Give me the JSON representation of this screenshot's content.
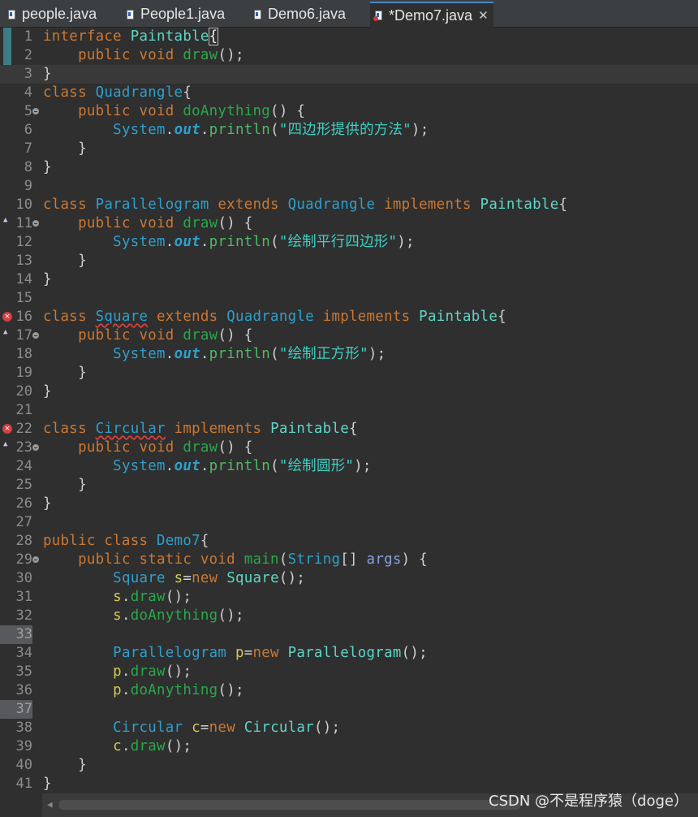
{
  "tabs": [
    {
      "label": "people.java",
      "icon": "java-file-icon"
    },
    {
      "label": "People1.java",
      "icon": "java-file-icon"
    },
    {
      "label": "Demo6.java",
      "icon": "java-file-icon"
    },
    {
      "label": "*Demo7.java",
      "icon": "java-file-error-icon",
      "close": "✕"
    }
  ],
  "editor": {
    "current_line": 3,
    "selected_line_numbers": [
      33,
      37
    ],
    "error_lines": [
      16,
      22
    ],
    "override_marker_lines": [
      11,
      17,
      23
    ],
    "fold_lines": [
      5,
      11,
      17,
      23,
      29
    ],
    "lines": [
      [
        [
          "kw",
          "interface "
        ],
        [
          "cls2",
          "Paintable"
        ],
        [
          "brk",
          "{"
        ]
      ],
      [
        [
          "pl",
          "    "
        ],
        [
          "kw",
          "public "
        ],
        [
          "kw",
          "void "
        ],
        [
          "fn",
          "draw"
        ],
        [
          "pl",
          "();"
        ]
      ],
      [
        [
          "pl",
          "}"
        ]
      ],
      [
        [
          "kw",
          "class "
        ],
        [
          "cls",
          "Quadrangle"
        ],
        [
          "pl",
          "{"
        ]
      ],
      [
        [
          "pl",
          "    "
        ],
        [
          "kw",
          "public "
        ],
        [
          "kw",
          "void "
        ],
        [
          "fn",
          "doAnything"
        ],
        [
          "pl",
          "() {"
        ]
      ],
      [
        [
          "pl",
          "        "
        ],
        [
          "cls",
          "System"
        ],
        [
          "pl",
          "."
        ],
        [
          "st",
          "out"
        ],
        [
          "pl",
          "."
        ],
        [
          "fnb",
          "println"
        ],
        [
          "pl",
          "("
        ],
        [
          "str",
          "\"四边形提供的方法\""
        ],
        [
          "pl",
          ");"
        ]
      ],
      [
        [
          "pl",
          "    }"
        ]
      ],
      [
        [
          "pl",
          "}"
        ]
      ],
      [],
      [
        [
          "kw",
          "class "
        ],
        [
          "cls",
          "Parallelogram "
        ],
        [
          "kw",
          "extends "
        ],
        [
          "cls",
          "Quadrangle "
        ],
        [
          "kw",
          "implements "
        ],
        [
          "cls2",
          "Paintable"
        ],
        [
          "pl",
          "{"
        ]
      ],
      [
        [
          "pl",
          "    "
        ],
        [
          "kw",
          "public "
        ],
        [
          "kw",
          "void "
        ],
        [
          "fn",
          "draw"
        ],
        [
          "pl",
          "() {"
        ]
      ],
      [
        [
          "pl",
          "        "
        ],
        [
          "cls",
          "System"
        ],
        [
          "pl",
          "."
        ],
        [
          "st",
          "out"
        ],
        [
          "pl",
          "."
        ],
        [
          "fnb",
          "println"
        ],
        [
          "pl",
          "("
        ],
        [
          "str",
          "\"绘制平行四边形\""
        ],
        [
          "pl",
          ");"
        ]
      ],
      [
        [
          "pl",
          "    }"
        ]
      ],
      [
        [
          "pl",
          "}"
        ]
      ],
      [],
      [
        [
          "kw",
          "class "
        ],
        [
          "cls wavy",
          "Square"
        ],
        [
          "pl",
          " "
        ],
        [
          "kw",
          "extends "
        ],
        [
          "cls",
          "Quadrangle "
        ],
        [
          "kw",
          "implements "
        ],
        [
          "cls2",
          "Paintable"
        ],
        [
          "pl",
          "{"
        ]
      ],
      [
        [
          "pl",
          "    "
        ],
        [
          "kw",
          "public "
        ],
        [
          "kw",
          "void "
        ],
        [
          "fn",
          "draw"
        ],
        [
          "pl",
          "() {"
        ]
      ],
      [
        [
          "pl",
          "        "
        ],
        [
          "cls",
          "System"
        ],
        [
          "pl",
          "."
        ],
        [
          "st",
          "out"
        ],
        [
          "pl",
          "."
        ],
        [
          "fnb",
          "println"
        ],
        [
          "pl",
          "("
        ],
        [
          "str",
          "\"绘制正方形\""
        ],
        [
          "pl",
          ");"
        ]
      ],
      [
        [
          "pl",
          "    }"
        ]
      ],
      [
        [
          "pl",
          "}"
        ]
      ],
      [],
      [
        [
          "kw",
          "class "
        ],
        [
          "cls wavy",
          "Circular"
        ],
        [
          "pl",
          " "
        ],
        [
          "kw",
          "implements "
        ],
        [
          "cls2",
          "Paintable"
        ],
        [
          "pl",
          "{"
        ]
      ],
      [
        [
          "pl",
          "    "
        ],
        [
          "kw",
          "public "
        ],
        [
          "kw",
          "void "
        ],
        [
          "fn",
          "draw"
        ],
        [
          "pl",
          "() {"
        ]
      ],
      [
        [
          "pl",
          "        "
        ],
        [
          "cls",
          "System"
        ],
        [
          "pl",
          "."
        ],
        [
          "st",
          "out"
        ],
        [
          "pl",
          "."
        ],
        [
          "fnb",
          "println"
        ],
        [
          "pl",
          "("
        ],
        [
          "str",
          "\"绘制圆形\""
        ],
        [
          "pl",
          ");"
        ]
      ],
      [
        [
          "pl",
          "    }"
        ]
      ],
      [
        [
          "pl",
          "}"
        ]
      ],
      [],
      [
        [
          "kw",
          "public "
        ],
        [
          "kw",
          "class "
        ],
        [
          "cls",
          "Demo7"
        ],
        [
          "pl",
          "{"
        ]
      ],
      [
        [
          "pl",
          "    "
        ],
        [
          "kw",
          "public "
        ],
        [
          "kw",
          "static "
        ],
        [
          "kw",
          "void "
        ],
        [
          "fn",
          "main"
        ],
        [
          "pl",
          "("
        ],
        [
          "cls",
          "String"
        ],
        [
          "pl",
          "[] "
        ],
        [
          "prm",
          "args"
        ],
        [
          "pl",
          ") {"
        ]
      ],
      [
        [
          "pl",
          "        "
        ],
        [
          "cls",
          "Square "
        ],
        [
          "var",
          "s"
        ],
        [
          "pl",
          "="
        ],
        [
          "kw",
          "new "
        ],
        [
          "cls2",
          "Square"
        ],
        [
          "pl",
          "();"
        ]
      ],
      [
        [
          "pl",
          "        "
        ],
        [
          "var",
          "s"
        ],
        [
          "pl",
          "."
        ],
        [
          "fn",
          "draw"
        ],
        [
          "pl",
          "();"
        ]
      ],
      [
        [
          "pl",
          "        "
        ],
        [
          "var",
          "s"
        ],
        [
          "pl",
          "."
        ],
        [
          "fn",
          "doAnything"
        ],
        [
          "pl",
          "();"
        ]
      ],
      [],
      [
        [
          "pl",
          "        "
        ],
        [
          "cls",
          "Parallelogram "
        ],
        [
          "var",
          "p"
        ],
        [
          "pl",
          "="
        ],
        [
          "kw",
          "new "
        ],
        [
          "cls2",
          "Parallelogram"
        ],
        [
          "pl",
          "();"
        ]
      ],
      [
        [
          "pl",
          "        "
        ],
        [
          "var",
          "p"
        ],
        [
          "pl",
          "."
        ],
        [
          "fn",
          "draw"
        ],
        [
          "pl",
          "();"
        ]
      ],
      [
        [
          "pl",
          "        "
        ],
        [
          "var",
          "p"
        ],
        [
          "pl",
          "."
        ],
        [
          "fn",
          "doAnything"
        ],
        [
          "pl",
          "();"
        ]
      ],
      [],
      [
        [
          "pl",
          "        "
        ],
        [
          "cls",
          "Circular "
        ],
        [
          "var",
          "c"
        ],
        [
          "pl",
          "="
        ],
        [
          "kw",
          "new "
        ],
        [
          "cls2",
          "Circular"
        ],
        [
          "pl",
          "();"
        ]
      ],
      [
        [
          "pl",
          "        "
        ],
        [
          "var",
          "c"
        ],
        [
          "pl",
          "."
        ],
        [
          "fn",
          "draw"
        ],
        [
          "pl",
          "();"
        ]
      ],
      [
        [
          "pl",
          "    }"
        ]
      ],
      [
        [
          "pl",
          "}"
        ]
      ]
    ]
  },
  "watermark": "CSDN @不是程序猿（doge）",
  "scrollbar": {
    "left_arrow": "◀"
  }
}
